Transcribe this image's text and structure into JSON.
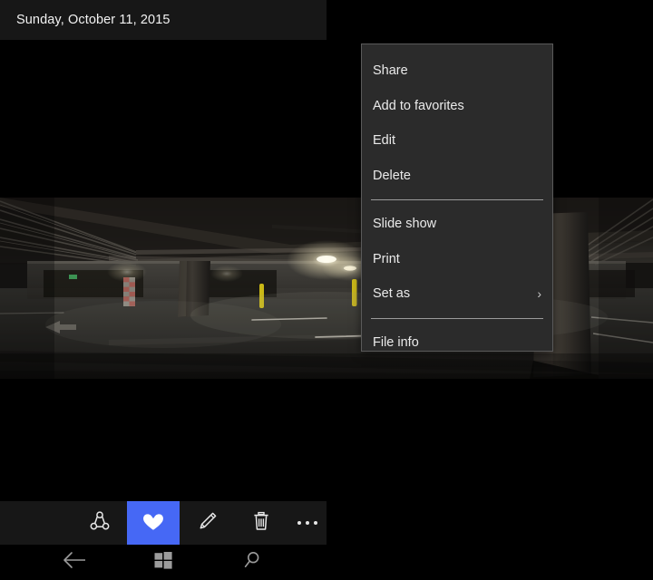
{
  "header": {
    "date": "Sunday, October 11, 2015"
  },
  "photo": {
    "alt": "underground parking garage interior",
    "description": "Dark empty underground concrete parking garage with ceiling pipes, support columns, yellow bollards, overhead lights and white painted parking lines"
  },
  "context_menu": {
    "items": [
      {
        "label": "Share",
        "icon": "",
        "has_submenu": false
      },
      {
        "label": "Add to favorites",
        "icon": "",
        "has_submenu": false
      },
      {
        "label": "Edit",
        "icon": "",
        "has_submenu": false
      },
      {
        "label": "Delete",
        "icon": "",
        "has_submenu": false
      },
      {
        "label": "Slide show",
        "icon": "",
        "has_submenu": false
      },
      {
        "label": "Print",
        "icon": "",
        "has_submenu": false
      },
      {
        "label": "Set as",
        "icon": "chevron-right-icon",
        "has_submenu": true,
        "chevron": "›"
      },
      {
        "label": "File info",
        "icon": "",
        "has_submenu": false
      }
    ]
  },
  "app_bar": {
    "buttons": [
      {
        "name": "share",
        "icon": "share-icon",
        "label": "Share",
        "selected": false
      },
      {
        "name": "favorite",
        "icon": "heart-icon",
        "label": "Add to favorites",
        "selected": true
      },
      {
        "name": "edit",
        "icon": "pencil-icon",
        "label": "Edit",
        "selected": false
      },
      {
        "name": "delete",
        "icon": "trash-icon",
        "label": "Delete",
        "selected": false
      },
      {
        "name": "more",
        "icon": "ellipsis-icon",
        "label": "See more",
        "selected": false
      }
    ],
    "accent_color": "#4668f5"
  },
  "nav_bar": {
    "buttons": [
      {
        "name": "back",
        "icon": "back-arrow-icon",
        "label": "Back"
      },
      {
        "name": "start",
        "icon": "windows-logo-icon",
        "label": "Start"
      },
      {
        "name": "search",
        "icon": "search-icon",
        "label": "Search"
      }
    ]
  },
  "colors": {
    "background": "#000000",
    "chrome": "#171717",
    "menu_background": "#2b2b2b",
    "menu_border": "#5a5a5a",
    "menu_text": "#eaeaea",
    "separator": "#9a9a9a",
    "accent": "#4668f5"
  }
}
